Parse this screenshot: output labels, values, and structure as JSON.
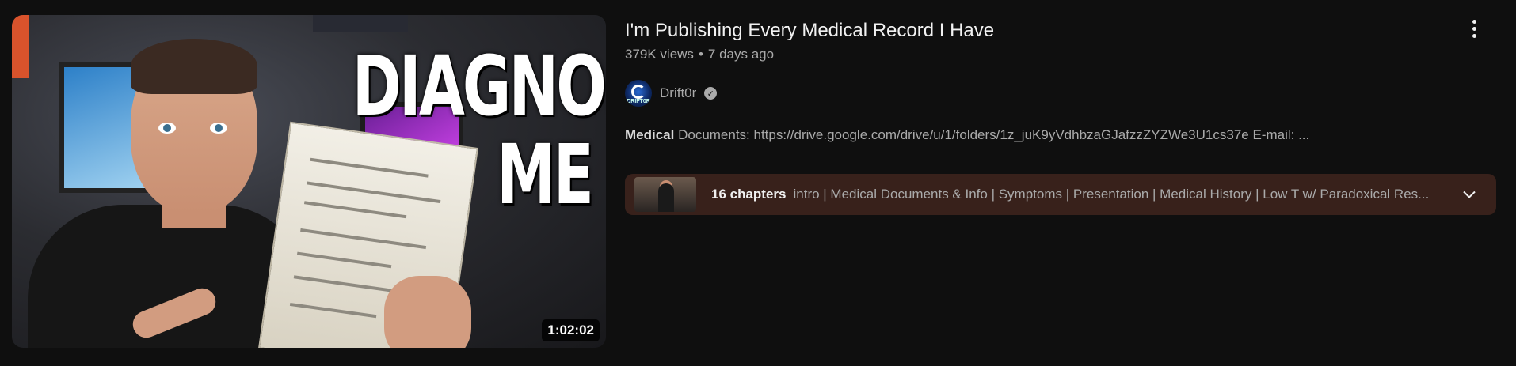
{
  "video": {
    "title": "I'm Publishing Every Medical Record I Have",
    "views": "379K views",
    "separator": "•",
    "age": "7 days ago",
    "duration": "1:02:02",
    "thumbnail_text_line1": "DIAGNOSE",
    "thumbnail_text_line2": "ME"
  },
  "channel": {
    "name": "Drift0r",
    "avatar_text": "DRIFT0R",
    "verified_icon": "check-icon"
  },
  "description": {
    "highlight": "Medical",
    "rest": " Documents: https://drive.google.com/drive/u/1/folders/1z_juK9yVdhbzaGJafzzZYZWe3U1cs37e E-mail: ..."
  },
  "chapters": {
    "count_label": "16 chapters",
    "list": "intro | Medical Documents & Info | Symptoms | Presentation | Medical History | Low T w/ Paradoxical Res...",
    "expand_icon": "chevron-down-icon"
  },
  "menu_icon": "more-vert-icon",
  "colors": {
    "background": "#0f0f0f",
    "chapters_bg": "#38211b",
    "secondary_text": "#aaaaaa"
  }
}
